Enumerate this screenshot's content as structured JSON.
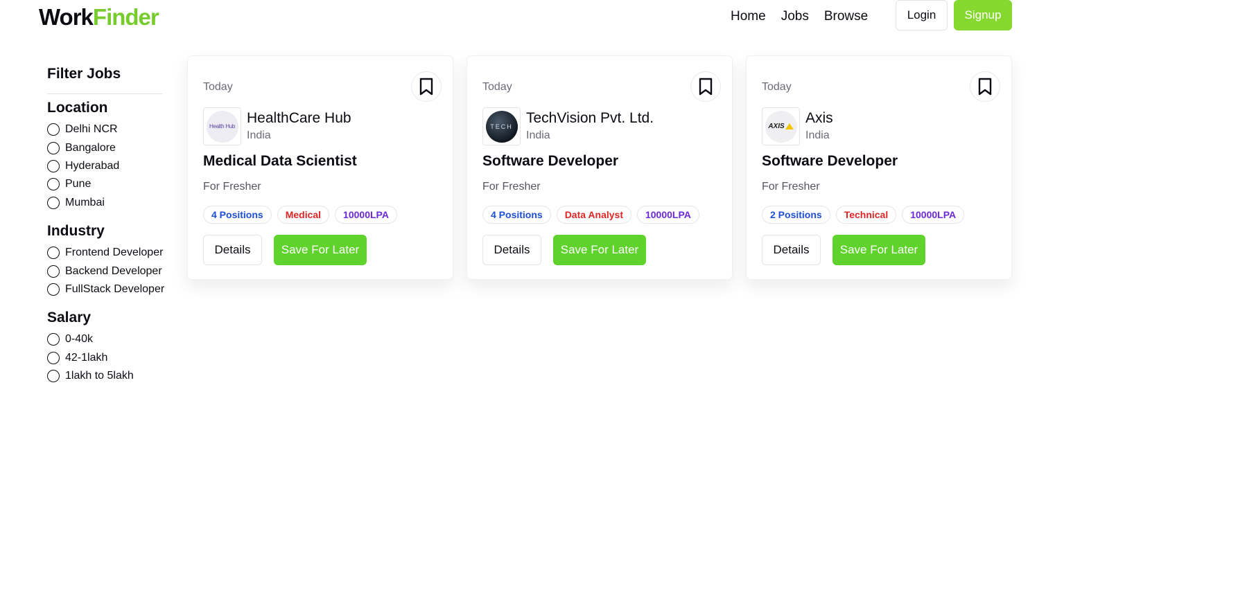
{
  "brand": {
    "part1": "Work",
    "part2": "Finder"
  },
  "nav": {
    "items": [
      "Home",
      "Jobs",
      "Browse"
    ],
    "login": "Login",
    "signup": "Signup"
  },
  "sidebar": {
    "title": "Filter Jobs",
    "groups": [
      {
        "title": "Location",
        "options": [
          "Delhi NCR",
          "Bangalore",
          "Hyderabad",
          "Pune",
          "Mumbai"
        ]
      },
      {
        "title": "Industry",
        "options": [
          "Frontend Developer",
          "Backend Developer",
          "FullStack Developer"
        ]
      },
      {
        "title": "Salary",
        "options": [
          "0-40k",
          "42-1lakh",
          "1lakh to 5lakh"
        ]
      }
    ]
  },
  "jobs": [
    {
      "date": "Today",
      "company": "HealthCare Hub",
      "country": "India",
      "logo_text": "Health Hub",
      "title": "Medical Data Scientist",
      "description": "For Fresher",
      "positions": "4 Positions",
      "category": "Medical",
      "salary": "10000LPA",
      "details_label": "Details",
      "save_label": "Save For Later"
    },
    {
      "date": "Today",
      "company": "TechVision Pvt. Ltd.",
      "country": "India",
      "logo_text": "TECH",
      "title": "Software Developer",
      "description": "For Fresher",
      "positions": "4 Positions",
      "category": "Data Analyst",
      "salary": "10000LPA",
      "details_label": "Details",
      "save_label": "Save For Later"
    },
    {
      "date": "Today",
      "company": "Axis",
      "country": "India",
      "logo_text": "AXIS",
      "title": "Software Developer",
      "description": "For Fresher",
      "positions": "2 Positions",
      "category": "Technical",
      "salary": "10000LPA",
      "details_label": "Details",
      "save_label": "Save For Later"
    }
  ],
  "colors": {
    "brand_green": "#76cc2c",
    "signup_bg": "#86d82f",
    "save_bg": "#5fd22c",
    "tag_blue": "#1d4ed8",
    "tag_red": "#dc2626",
    "tag_purple": "#6d28d9"
  },
  "icons": [
    "bookmark-icon",
    "radio-icon",
    "company-logo"
  ]
}
